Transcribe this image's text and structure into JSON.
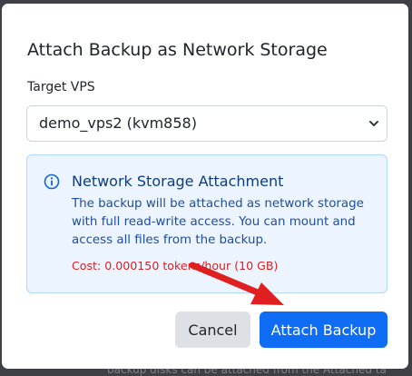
{
  "backdrop": {
    "partial_text": "backup disks can be attached from the Attached ta"
  },
  "modal": {
    "title": "Attach Backup as Network Storage",
    "target_label": "Target VPS",
    "target_select": {
      "value": "demo_vps2 (kvm858)"
    },
    "info": {
      "icon": "info-circle-icon",
      "title": "Network Storage Attachment",
      "body": "The backup will be attached as network storage with full read-write access. You can mount and access all files from the backup.",
      "cost": "Cost: 0.000150 tokens/hour (10 GB)"
    },
    "buttons": {
      "cancel": "Cancel",
      "attach": "Attach Backup"
    }
  },
  "colors": {
    "primary": "#0f6cf4",
    "cost_red": "#dc1f1f",
    "arrow_red": "#e02020",
    "info_bg": "#ebf4ff"
  }
}
